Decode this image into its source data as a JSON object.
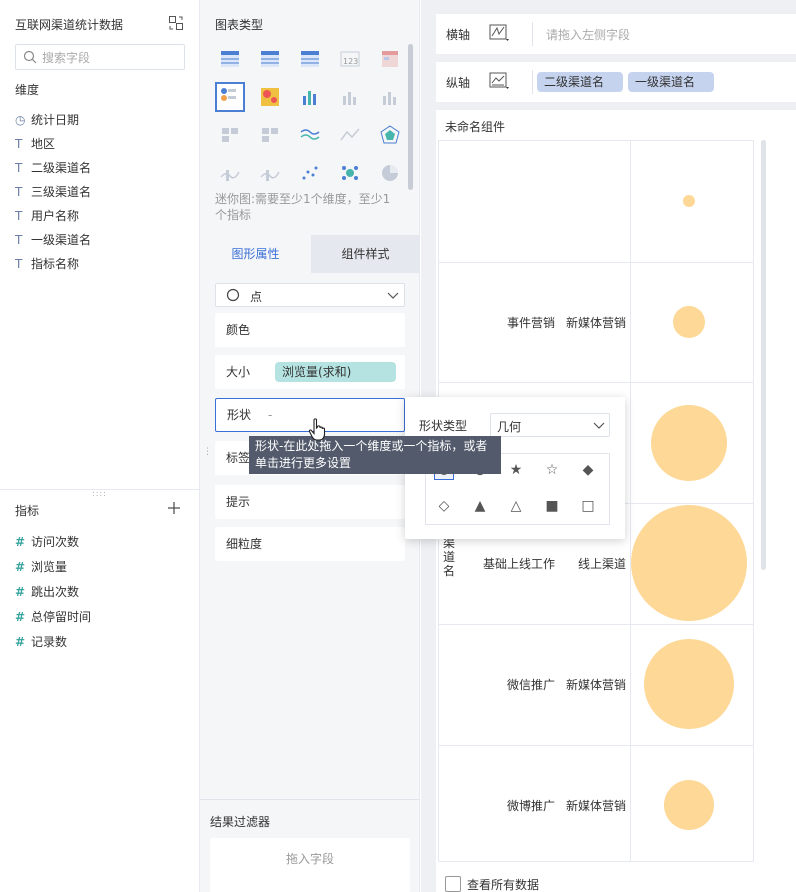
{
  "left": {
    "title": "互联网渠道统计数据",
    "search_placeholder": "搜索字段",
    "dimension_header": "维度",
    "dimensions": [
      {
        "icon": "clock-icon",
        "label": "统计日期"
      },
      {
        "icon": "text-type-icon",
        "label": "地区"
      },
      {
        "icon": "text-type-icon",
        "label": "二级渠道名"
      },
      {
        "icon": "text-type-icon",
        "label": "三级渠道名"
      },
      {
        "icon": "text-type-icon",
        "label": "用户名称"
      },
      {
        "icon": "text-type-icon",
        "label": "一级渠道名"
      },
      {
        "icon": "text-type-icon",
        "label": "指标名称"
      }
    ],
    "measure_header": "指标",
    "measures": [
      {
        "icon": "hash-icon",
        "label": "访问次数"
      },
      {
        "icon": "hash-icon",
        "label": "浏览量"
      },
      {
        "icon": "hash-icon",
        "label": "跳出次数"
      },
      {
        "icon": "hash-icon",
        "label": "总停留时间"
      },
      {
        "icon": "hash-icon",
        "label": "记录数"
      }
    ]
  },
  "mid": {
    "chart_type_header": "图表类型",
    "chart_hint": "迷你图:需要至少1个维度，至少1个指标",
    "tabs": [
      "图形属性",
      "组件样式"
    ],
    "mark_type": "点",
    "props": {
      "color": "颜色",
      "size": "大小",
      "size_value": "浏览量(求和)",
      "shape": "形状",
      "shape_value": "-",
      "label": "标签",
      "tooltip": "提示",
      "granularity": "细粒度"
    },
    "filter_header": "结果过滤器",
    "filter_drop": "拖入字段"
  },
  "tooltip": "形状-在此处拖入一个维度或一个指标，或者单击进行更多设置",
  "shape_popup": {
    "label": "形状类型",
    "selected": "几何"
  },
  "right": {
    "x_axis_label": "横轴",
    "x_axis_placeholder": "请拖入左侧字段",
    "y_axis_label": "纵轴",
    "y_fields": [
      "二级渠道名",
      "一级渠道名"
    ],
    "component_title": "未命名组件",
    "view_all": "查看所有数据",
    "y_header_fragment": "渠道名"
  },
  "chart_data": {
    "type": "scatter",
    "title": "未命名组件",
    "rows": [
      {
        "level2": "",
        "level1": "",
        "size": 6
      },
      {
        "level2": "事件营销",
        "level1": "新媒体营销",
        "size": 16
      },
      {
        "level2": "",
        "level1": "",
        "size": 38
      },
      {
        "level2": "基础上线工作",
        "level1": "线上渠道",
        "size": 58
      },
      {
        "level2": "微信推广",
        "level1": "新媒体营销",
        "size": 45
      },
      {
        "level2": "微博推广",
        "level1": "新媒体营销",
        "size": 25
      }
    ],
    "mark_color": "#fdd896"
  },
  "colors": {
    "accent": "#3a6fd8",
    "pill_blue": "#c6d3ee",
    "pill_teal": "#b5e3e1",
    "bubble": "#fdd896"
  }
}
